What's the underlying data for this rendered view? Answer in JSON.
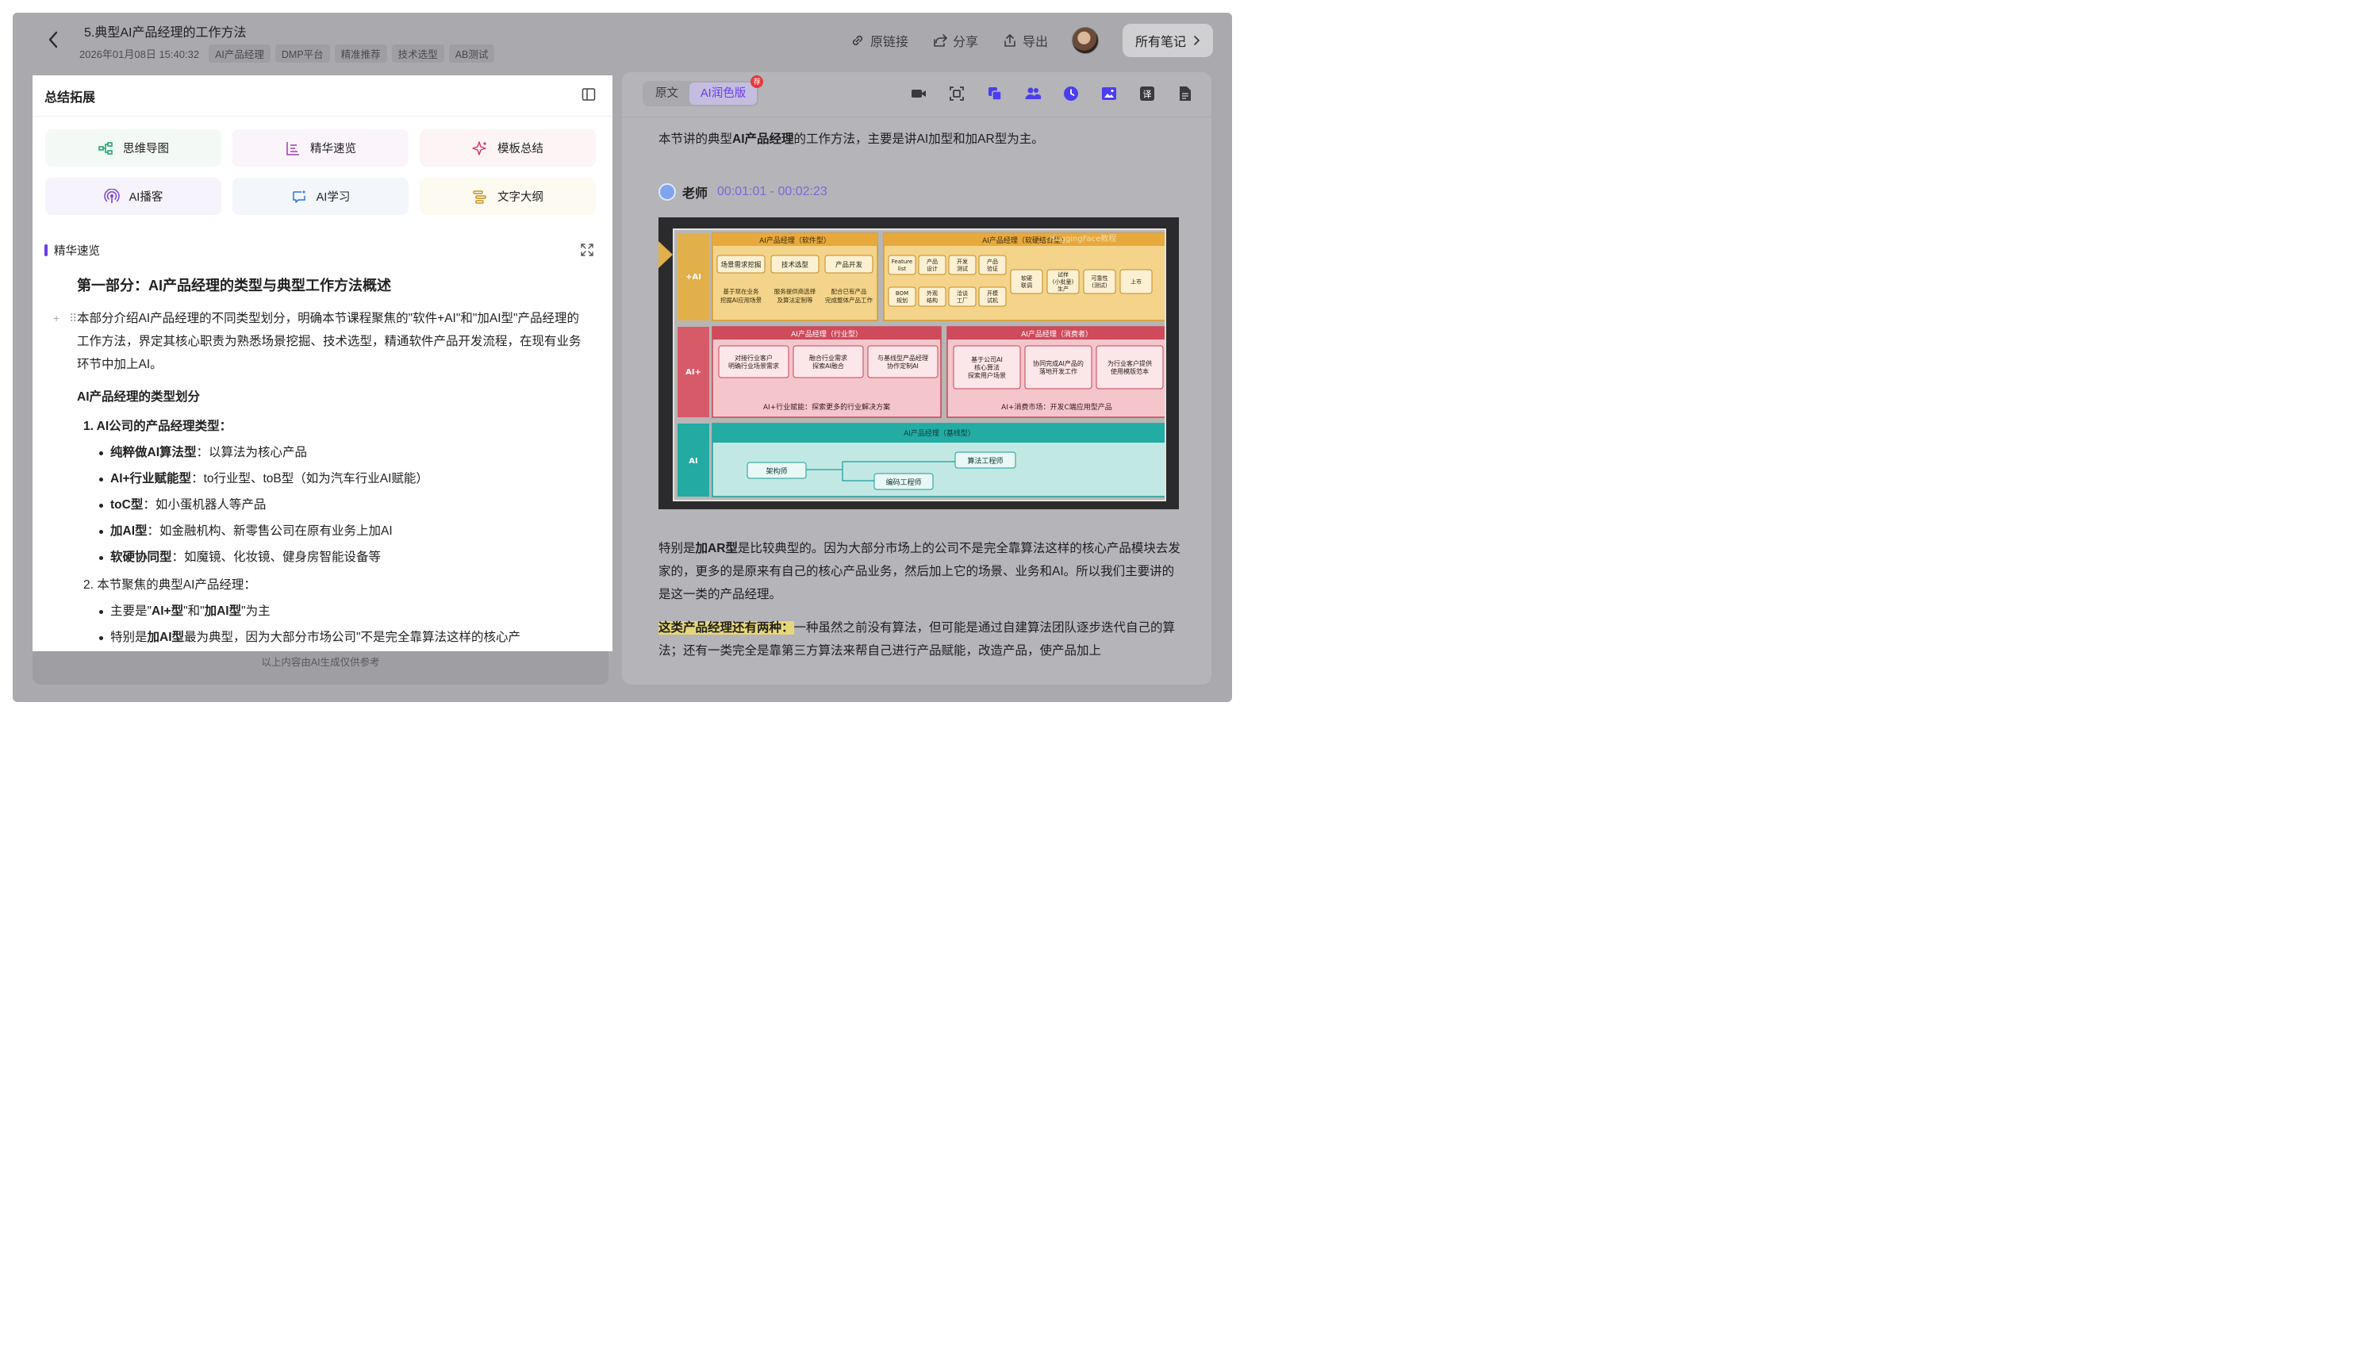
{
  "header": {
    "title": "5.典型AI产品经理的工作方法",
    "datetime": "2026年01月08日 15:40:32",
    "tags": [
      "AI产品经理",
      "DMP平台",
      "精准推荐",
      "技术选型",
      "AB测试"
    ],
    "actions": {
      "source_link": "原链接",
      "share": "分享",
      "export": "导出",
      "all_notes": "所有笔记"
    }
  },
  "left": {
    "title": "总结拓展",
    "tools": [
      "思维导图",
      "精华速览",
      "模板总结",
      "AI播客",
      "AI学习",
      "文字大纲"
    ],
    "section_label": "精华速览",
    "heading": "第一部分：AI产品经理的类型与典型工作方法概述",
    "lead": "本部分介绍AI产品经理的不同类型划分，明确本节课程聚焦的\"软件+AI\"和\"加AI型\"产品经理的工作方法，界定其核心职责为熟悉场景挖掘、技术选型，精通软件产品开发流程，在现有业务环节中加上AI。",
    "subheading": "AI产品经理的类型划分",
    "list1_title": "1. AI公司的产品经理类型：",
    "list1": [
      {
        "b": "纯粹做AI算法型",
        "t": "：以算法为核心产品"
      },
      {
        "b": "AI+行业赋能型",
        "t": "：to行业型、toB型（如为汽车行业AI赋能）"
      },
      {
        "b": "toC型",
        "t": "：如小蛋机器人等产品"
      },
      {
        "b": "加AI型",
        "t": "：如金融机构、新零售公司在原有业务上加AI"
      },
      {
        "b": "软硬协同型",
        "t": "：如魔镜、化妆镜、健身房智能设备等"
      }
    ],
    "list2_title": "2. 本节聚焦的典型AI产品经理：",
    "list2_item1": {
      "a": "主要是\"",
      "b1": "AI+型",
      "c": "\"和\"",
      "b2": "加AI型",
      "d": "\"为主"
    },
    "list2_item2": {
      "a": "特别是",
      "b": "加AI型",
      "c": "最为典型，因为大部分市场公司\"不是完全靠算法这样的核心产"
    },
    "disclaimer": "以上内容由AI生成仅供参考"
  },
  "right": {
    "tabs": [
      "原文",
      "AI润色版"
    ],
    "badge": "荐",
    "intro": {
      "a": "本节讲的典型",
      "b": "AI产品经理",
      "c": "的工作方法，主要是讲AI加型和加AR型为主。"
    },
    "speaker": {
      "name": "老师",
      "time": "00:01:01 - 00:02:23"
    },
    "para2": {
      "a": "特别是",
      "b": "加AR型",
      "c": "是比较典型的。因为大部分市场上的公司不是完全靠算法这样的核心产品模块去发家的，更多的是原来有自己的核心产品业务，然后加上它的场景、业务和AI。所以我们主要讲的是这一类的产品经理。"
    },
    "para3": {
      "hl": "这类产品经理还有两种：",
      "rest": "一种虽然之前没有算法，但可能是通过自建算法团队逐步迭代自己的算法；还有一类完全是靠第三方算法来帮自己进行产品赋能，改造产品，使产品加上"
    }
  },
  "slide": {
    "watermark": "HuggingFace教程",
    "rows": [
      {
        "tag": "+AI",
        "color": "#e8b94a"
      },
      {
        "tag": "AI+",
        "color": "#d85a68"
      },
      {
        "tag": "AI",
        "color": "#25b0a8"
      }
    ],
    "sw_title": "AI产品经理（软件型）",
    "sw_items": [
      "场景需求挖掘",
      "技术选型",
      "产品开发"
    ],
    "sw_notes": [
      "基于现在业务\n挖掘AI应用场景",
      "服务提供商选择\n及算法定制等",
      "配合已有产品\n完成整体产品工作"
    ],
    "hw_title": "AI产品经理（软硬结合型）",
    "hw_top": [
      "Feature\nlist",
      "产品\n设计",
      "开发\n测试",
      "产品\n验证"
    ],
    "hw_bottom": [
      "BOM\n规划",
      "外观\n结构",
      "洽谈\n工厂",
      "开模\n试机"
    ],
    "hw_mid": [
      "软硬\n联调",
      "试样\n(小批量)\n生产",
      "可靠性\n(测试)",
      "上市"
    ],
    "ind_title": "AI产品经理（行业型）",
    "ind_items": [
      "对接行业客户\n明确行业场景需求",
      "融合行业需求\n探索AI融合",
      "与基线型产品经理\n协作定制AI"
    ],
    "ind_note": "AI+行业赋能：探索更多的行业解决方案",
    "con_title": "AI产品经理（消费者）",
    "con_items": [
      "基于公司AI\n核心算法\n探索用户场景",
      "协同完成AI产品的\n落地开发工作",
      "为行业客户提供\n使用模版范本"
    ],
    "con_note": "AI+消费市场：开发C端应用型产品",
    "base_title": "AI产品经理（基线型）",
    "base_items": [
      "架构师",
      "算法工程师",
      "编码工程师"
    ]
  },
  "colors": {
    "accent": "#6a3df0",
    "highlight": "#e6d77a"
  }
}
